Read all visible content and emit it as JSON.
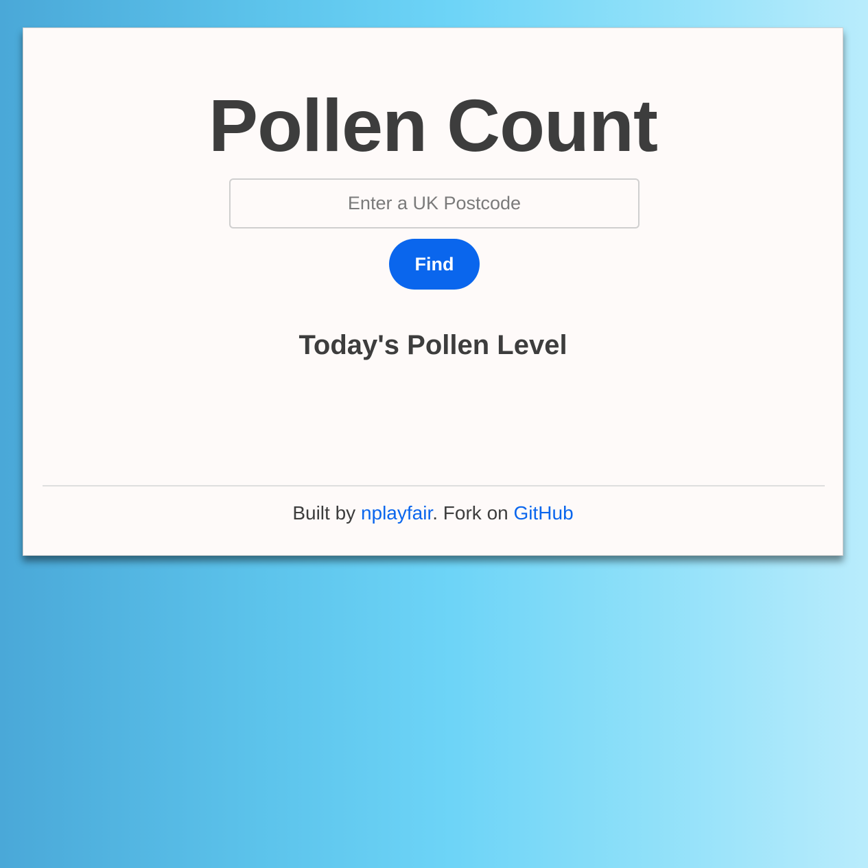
{
  "app": {
    "title": "Pollen Count"
  },
  "search": {
    "placeholder": "Enter a UK Postcode",
    "value": "",
    "button_label": "Find"
  },
  "result": {
    "heading": "Today's Pollen Level"
  },
  "footer": {
    "built_by_prefix": "Built by ",
    "author_link": "nplayfair",
    "fork_text": ". Fork on ",
    "github_link": "GitHub"
  },
  "colors": {
    "accent": "#0a66ed",
    "text": "#3d3d3d",
    "card_background": "#fefaf9"
  }
}
